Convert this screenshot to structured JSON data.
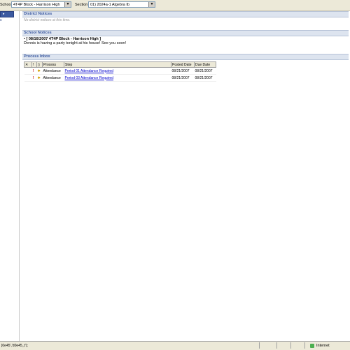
{
  "topbar": {
    "school_label": "School",
    "school_value": "4T4P Block - Harrison High",
    "section_label": "Section",
    "section_value": "01) 2024a-1 Algebra Ib"
  },
  "leftnav": {
    "items": [
      "s"
    ]
  },
  "district_notices": {
    "title": "District Notices",
    "empty": "No district notices at this time."
  },
  "school_notices": {
    "title": "School Notices",
    "notice_title": "[ 08/16/2007 4T4P Block - Harrison High ]",
    "notice_body": "Dennis is having a party tonight at his house! See you soon!"
  },
  "process_inbox": {
    "title": "Process Inbox",
    "columns": [
      "Process",
      "Step",
      "Posted Date",
      "Due Date"
    ],
    "rows": [
      {
        "process": "Attendance",
        "step": "Period 01 Attendance Required",
        "posted": "08/21/2007",
        "due": "08/21/2007"
      },
      {
        "process": "Attendance",
        "step": "Period 03 Attendance Required",
        "posted": "08/21/2007",
        "due": "08/21/2007"
      }
    ]
  },
  "statusbar": {
    "text": "]0e45','d0e45_t');",
    "zone": "Internet"
  }
}
